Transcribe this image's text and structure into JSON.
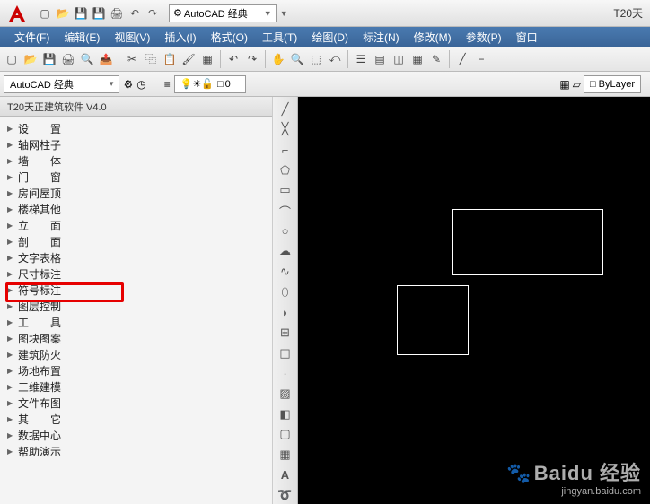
{
  "workspace_selector": "AutoCAD 经典",
  "title_suffix": "T20天",
  "menu": [
    "文件(F)",
    "编辑(E)",
    "视图(V)",
    "插入(I)",
    "格式(O)",
    "工具(T)",
    "绘图(D)",
    "标注(N)",
    "修改(M)",
    "参数(P)",
    "窗口"
  ],
  "layer_combo": "AutoCAD 经典",
  "layer_zero": "0",
  "bylayer_label": "ByLayer",
  "panel_title": "T20天正建筑软件 V4.0",
  "tree": [
    "设　　置",
    "轴网柱子",
    "墙　　体",
    "门　　窗",
    "房间屋顶",
    "楼梯其他",
    "立　　面",
    "剖　　面",
    "文字表格",
    "尺寸标注",
    "符号标注",
    "图层控制",
    "工　　具",
    "图块图案",
    "建筑防火",
    "场地布置",
    "三维建模",
    "文件布图",
    "其　　它",
    "数据中心",
    "帮助演示"
  ],
  "highlight_index": 10,
  "watermark": {
    "brand": "Baidu 经验",
    "url": "jingyan.baidu.com"
  }
}
